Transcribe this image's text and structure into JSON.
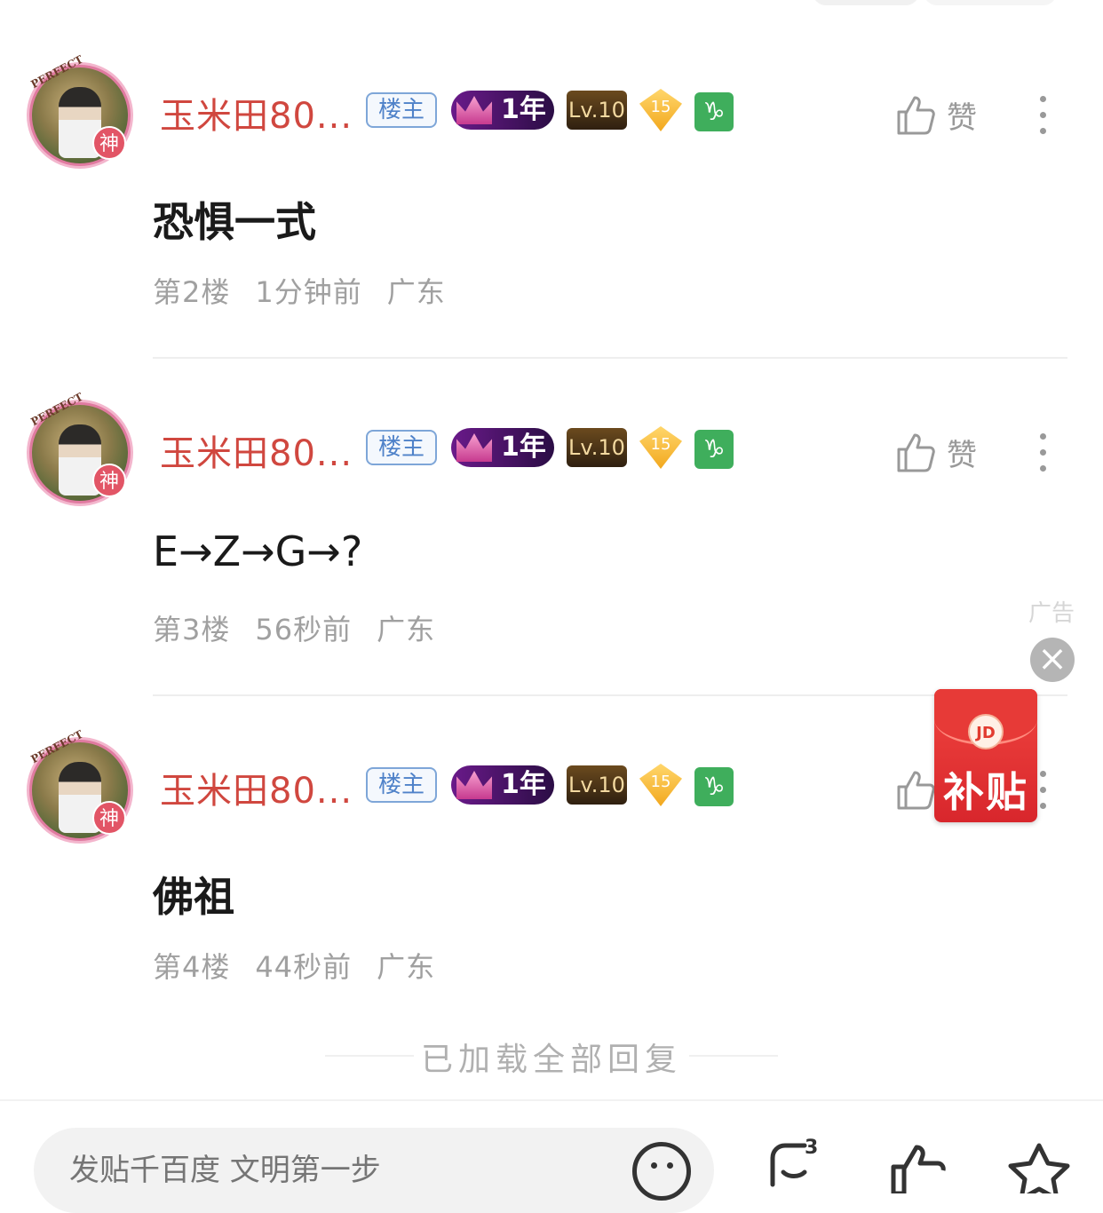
{
  "posts": [
    {
      "username": "玉米田80...",
      "owner_tag": "楼主",
      "year_badge": "1年",
      "level_badge": "Lv.10",
      "gem_badge": "15",
      "zodiac_badge": "♑",
      "avatar_text": "PERFECT",
      "avatar_badge": "神",
      "like_label": "赞",
      "content": "恐惧一式",
      "floor": "第2楼",
      "time": "1分钟前",
      "location": "广东"
    },
    {
      "username": "玉米田80...",
      "owner_tag": "楼主",
      "year_badge": "1年",
      "level_badge": "Lv.10",
      "gem_badge": "15",
      "zodiac_badge": "♑",
      "avatar_text": "PERFECT",
      "avatar_badge": "神",
      "like_label": "赞",
      "content": "E→Z→G→?",
      "floor": "第3楼",
      "time": "56秒前",
      "location": "广东"
    },
    {
      "username": "玉米田80...",
      "owner_tag": "楼主",
      "year_badge": "1年",
      "level_badge": "Lv.10",
      "gem_badge": "15",
      "zodiac_badge": "♑",
      "avatar_text": "PERFECT",
      "avatar_badge": "神",
      "like_label": "赞",
      "content": "佛祖",
      "floor": "第4楼",
      "time": "44秒前",
      "location": "广东"
    }
  ],
  "ad": {
    "label": "广告",
    "close_glyph": "×",
    "logo": "JD",
    "text": "补贴"
  },
  "footer": {
    "loaded_all": "已加载全部回复"
  },
  "bottom_bar": {
    "reply_placeholder": "发贴千百度 文明第一步",
    "comment_count": "3"
  },
  "colors": {
    "username": "#d0473f",
    "owner_tag": "#4f82c9",
    "meta": "#a0a0a0",
    "ad_red": "#e23b2f"
  }
}
